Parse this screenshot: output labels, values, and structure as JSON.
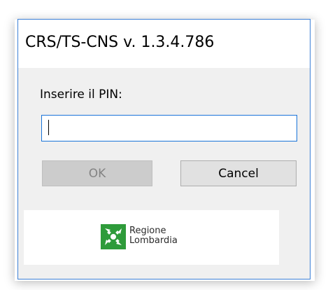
{
  "window": {
    "title": "CRS/TS-CNS v. 1.3.4.786"
  },
  "form": {
    "pin_label": "Inserire il PIN:",
    "pin_value": ""
  },
  "buttons": {
    "ok_label": "OK",
    "cancel_label": "Cancel"
  },
  "logo": {
    "line1": "Regione",
    "line2": "Lombardia",
    "icon": "regione-lombardia-logo-icon",
    "color": "#2e9b3a"
  },
  "colors": {
    "window_border": "#3c80d6",
    "input_border": "#1a74d9",
    "dialog_background": "#f0f0f0"
  }
}
